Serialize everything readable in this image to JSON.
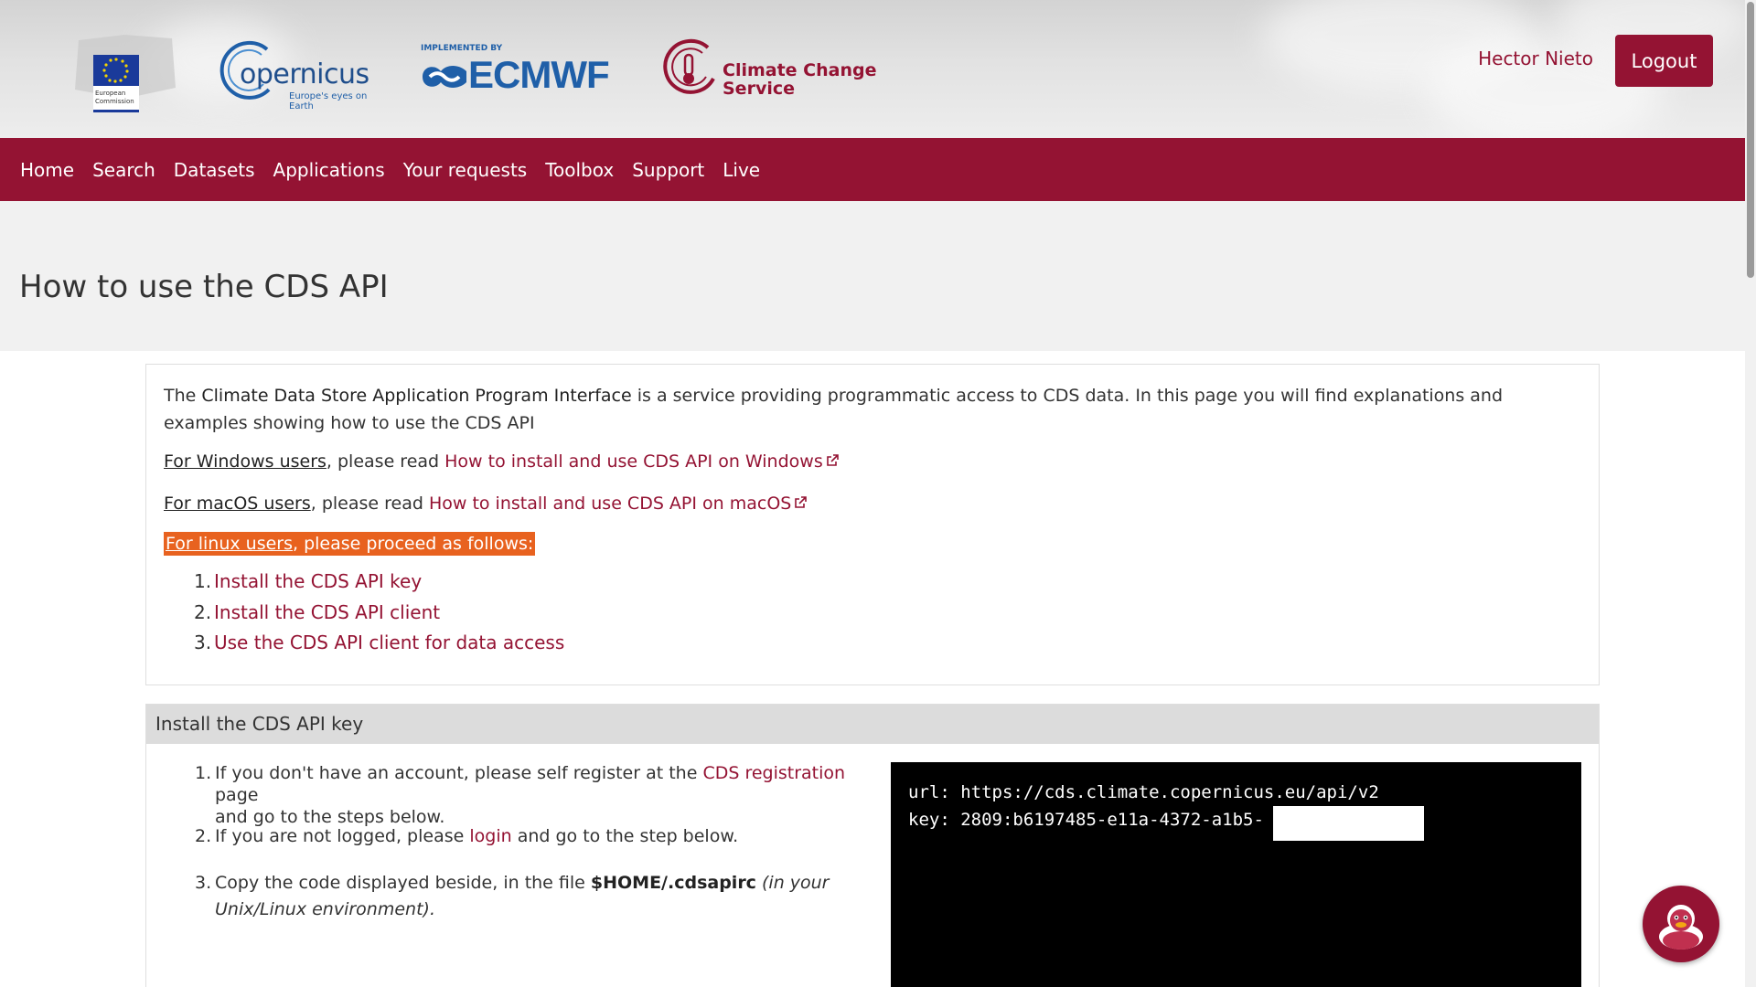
{
  "header": {
    "logos": {
      "ec": {
        "icon": "european-commission-logo",
        "text_line1": "European",
        "text_line2": "Commission"
      },
      "copernicus": {
        "icon": "copernicus-logo",
        "name": "opernicus",
        "tagline": "Europe's eyes on Earth"
      },
      "ecmwf": {
        "icon": "ecmwf-logo",
        "caption": "IMPLEMENTED BY",
        "name": "ECMWF"
      },
      "c3s": {
        "icon": "climate-change-service-logo",
        "line1": "Climate Change",
        "line2": "Service"
      }
    },
    "user_name": "Hector Nieto",
    "logout_label": "Logout"
  },
  "nav": {
    "items": [
      {
        "label": "Home"
      },
      {
        "label": "Search"
      },
      {
        "label": "Datasets"
      },
      {
        "label": "Applications"
      },
      {
        "label": "Your requests"
      },
      {
        "label": "Toolbox"
      },
      {
        "label": "Support"
      },
      {
        "label": "Live"
      }
    ]
  },
  "page": {
    "title": "How to use the CDS API"
  },
  "intro": {
    "pre": "The ",
    "strong": "Climate Data Store Application Program Interface",
    "post": " is a service providing programmatic access to CDS data. In this page you will find explanations and examples showing how to use the CDS API",
    "windows": {
      "label": "For Windows users",
      "middle": ", please read ",
      "link": "How to install and use CDS API on Windows"
    },
    "macos": {
      "label": "For macOS users",
      "middle": ", please read ",
      "link": "How to install and use CDS API on macOS"
    },
    "linux": {
      "label": "For linux users",
      "rest": ", please proceed as follows:"
    },
    "steps": [
      {
        "num": "1.",
        "label": "Install the CDS API key"
      },
      {
        "num": "2.",
        "label": "Install the CDS API client"
      },
      {
        "num": "3.",
        "label": "Use the CDS API client for data access"
      }
    ]
  },
  "install_key": {
    "title": "Install the CDS API key",
    "step1": {
      "num": "1.",
      "pre": "If you don't have an account, please self register at the ",
      "link": "CDS registration",
      "post": " page",
      "line2": "and go to the steps below."
    },
    "step2": {
      "num": "2.",
      "pre": "If you are not logged, please ",
      "link": "login",
      "post": " and go to the step below."
    },
    "step3": {
      "num": "3.",
      "pre": "Copy the code displayed beside, in the file ",
      "file": "$HOME/.cdsapirc",
      "italic1": "(in your",
      "italic2": "Unix/Linux environment)."
    },
    "code": {
      "line1": "url: https://cds.climate.copernicus.eu/api/v2",
      "line2": "key: 2809:b6197485-e11a-4372-a1b5-"
    }
  },
  "colors": {
    "brand": "#941333",
    "highlight": "#e8621f",
    "title_band": "#f1f1f1",
    "section_head": "#dcdcdc"
  },
  "chat": {
    "icon": "duck-chat-icon"
  }
}
